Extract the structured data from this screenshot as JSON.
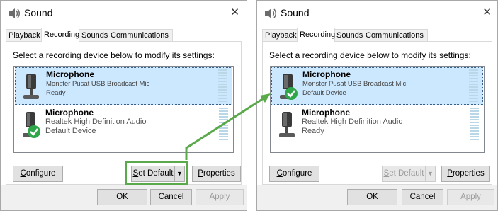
{
  "colors": {
    "selection_bg": "#cce8ff",
    "highlight_green": "#5aa94a",
    "check_green": "#2fa64a",
    "meter_segment": "#b9d7e7"
  },
  "left_window": {
    "title": "Sound",
    "tabs": [
      {
        "label": "Playback",
        "active": false
      },
      {
        "label": "Recording",
        "active": true
      },
      {
        "label": "Sounds",
        "active": false
      },
      {
        "label": "Communications",
        "active": false
      }
    ],
    "instruction": "Select a recording device below to modify its settings:",
    "devices": [
      {
        "name": "Microphone",
        "description": "Monster Pusat USB Broadcast Mic",
        "state": "Ready",
        "selected": true,
        "default": false,
        "icon": "microphone-icon"
      },
      {
        "name": "Microphone",
        "description": "Realtek High Definition Audio",
        "state": "Default Device",
        "selected": false,
        "default": true,
        "icon": "microphone-icon"
      }
    ],
    "buttons": {
      "configure": {
        "prefix": "",
        "mnemonic": "C",
        "rest": "onfigure",
        "enabled": true
      },
      "set_default": {
        "prefix": "",
        "mnemonic": "S",
        "rest": "et Default",
        "enabled": true,
        "highlighted": true
      },
      "properties": {
        "prefix": "",
        "mnemonic": "P",
        "rest": "roperties",
        "enabled": true
      },
      "ok": {
        "label": "OK",
        "enabled": true
      },
      "cancel": {
        "label": "Cancel",
        "enabled": true
      },
      "apply": {
        "prefix": "",
        "mnemonic": "A",
        "rest": "pply",
        "enabled": false
      }
    }
  },
  "right_window": {
    "title": "Sound",
    "tabs": [
      {
        "label": "Playback",
        "active": false
      },
      {
        "label": "Recording",
        "active": true
      },
      {
        "label": "Sounds",
        "active": false
      },
      {
        "label": "Communications",
        "active": false
      }
    ],
    "instruction": "Select a recording device below to modify its settings:",
    "devices": [
      {
        "name": "Microphone",
        "description": "Monster Pusat USB Broadcast Mic",
        "state": "Default Device",
        "selected": true,
        "default": true,
        "icon": "microphone-icon"
      },
      {
        "name": "Microphone",
        "description": "Realtek High Definition Audio",
        "state": "Ready",
        "selected": false,
        "default": false,
        "icon": "microphone-icon"
      }
    ],
    "buttons": {
      "configure": {
        "prefix": "",
        "mnemonic": "C",
        "rest": "onfigure",
        "enabled": true
      },
      "set_default": {
        "prefix": "",
        "mnemonic": "S",
        "rest": "et Default",
        "enabled": false,
        "highlighted": false
      },
      "properties": {
        "prefix": "",
        "mnemonic": "P",
        "rest": "roperties",
        "enabled": true
      },
      "ok": {
        "label": "OK",
        "enabled": true
      },
      "cancel": {
        "label": "Cancel",
        "enabled": true
      },
      "apply": {
        "prefix": "",
        "mnemonic": "A",
        "rest": "pply",
        "enabled": false
      }
    }
  }
}
